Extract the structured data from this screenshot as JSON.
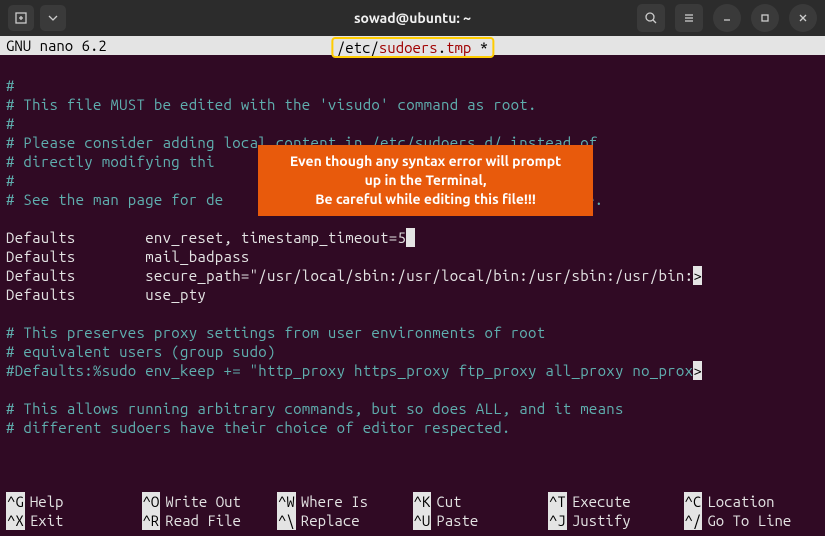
{
  "titlebar": {
    "title": "sowad@ubuntu: ~"
  },
  "nano": {
    "app": "  GNU nano 6.2",
    "filepath": {
      "p1": " /etc",
      "slash": "/",
      "p2": "sudoers",
      "dot": ".",
      "p3": "tmp",
      "star": " * "
    }
  },
  "callout": {
    "l1": "Even though any syntax error will prompt",
    "l2": "up in the Terminal,",
    "l3": "Be careful while editing this file!!!"
  },
  "file": {
    "l1": "#",
    "l2": "# This file MUST be edited with the 'visudo' command as root.",
    "l3": "#",
    "l4": "# Please consider adding local content in /etc/sudoers.d/ instead of",
    "l5": "# directly modifying thi",
    "l6": "#",
    "l7": "# See the man page for de",
    "l7b": "ile.",
    "l8": "",
    "l9a": "Defaults        env_reset, timestamp_timeout=5",
    "l10": "Defaults        mail_badpass",
    "l11": "Defaults        secure_path=\"/usr/local/sbin:/usr/local/bin:/usr/sbin:/usr/bin:",
    "l12": "Defaults        use_pty",
    "l13": "",
    "l14": "# This preserves proxy settings from user environments of root",
    "l15": "# equivalent users (group sudo)",
    "l16": "#Defaults:%sudo env_keep += \"http_proxy https_proxy ftp_proxy all_proxy no_prox",
    "l17": "",
    "l18": "# This allows running arbitrary commands, but so does ALL, and it means",
    "l19": "# different sudoers have their choice of editor respected."
  },
  "shortcuts": {
    "r1": [
      {
        "k": "^G",
        "l": "Help"
      },
      {
        "k": "^O",
        "l": "Write Out"
      },
      {
        "k": "^W",
        "l": "Where Is"
      },
      {
        "k": "^K",
        "l": "Cut"
      },
      {
        "k": "^T",
        "l": "Execute"
      },
      {
        "k": "^C",
        "l": "Location"
      }
    ],
    "r2": [
      {
        "k": "^X",
        "l": "Exit"
      },
      {
        "k": "^R",
        "l": "Read File"
      },
      {
        "k": "^\\",
        "l": "Replace"
      },
      {
        "k": "^U",
        "l": "Paste"
      },
      {
        "k": "^J",
        "l": "Justify"
      },
      {
        "k": "^/",
        "l": "Go To Line"
      }
    ]
  }
}
